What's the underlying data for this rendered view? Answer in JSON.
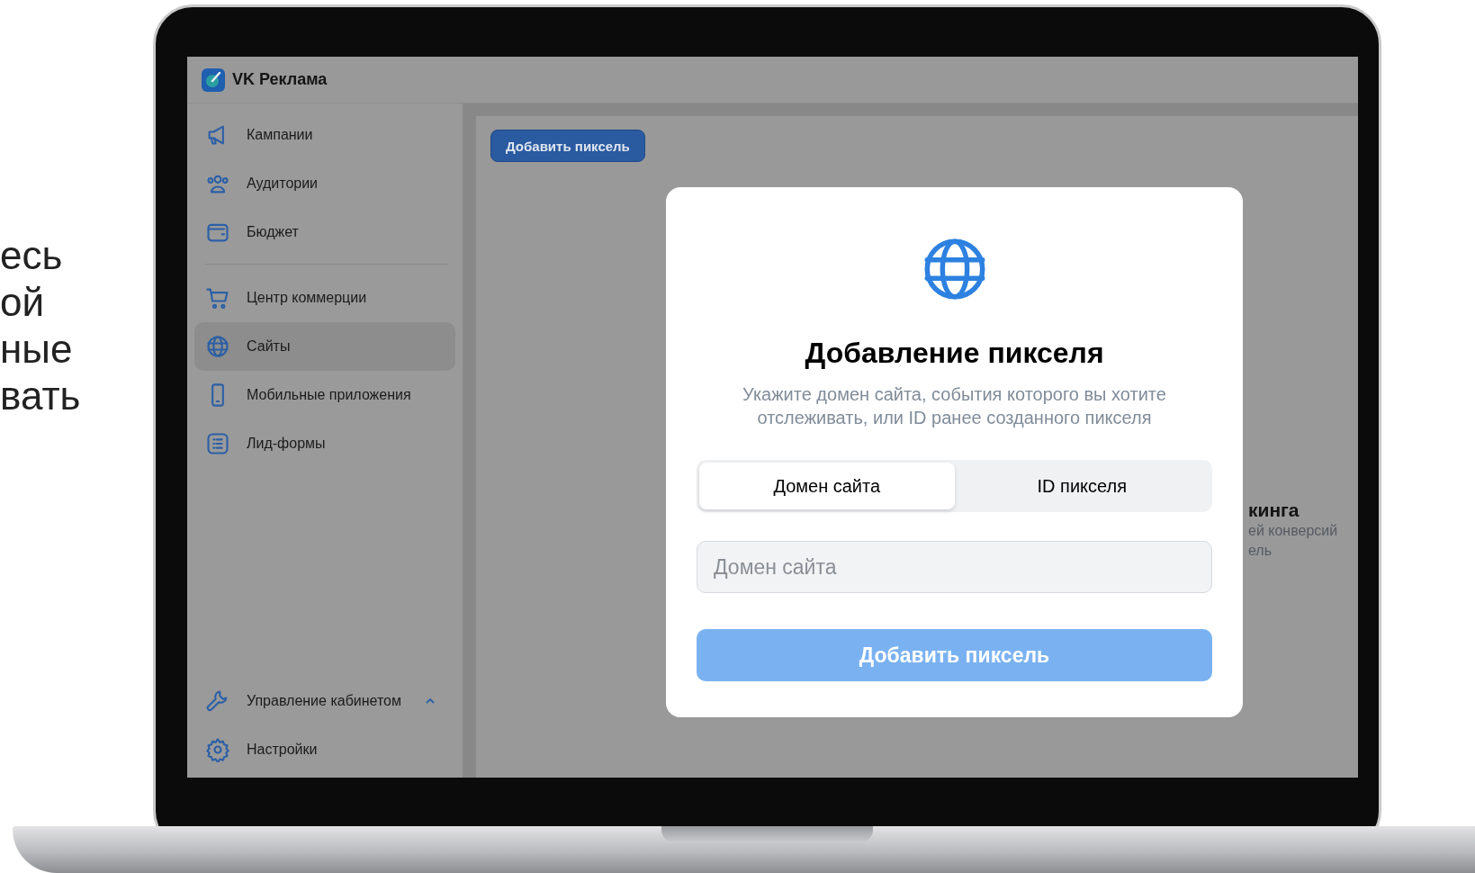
{
  "side_text": [
    "есь",
    "ой",
    "ные",
    "вать"
  ],
  "app": {
    "title": "VK Реклама"
  },
  "sidebar": {
    "items": [
      {
        "label": "Кампании",
        "selected": false
      },
      {
        "label": "Аудитории",
        "selected": false
      },
      {
        "label": "Бюджет",
        "selected": false
      },
      {
        "label": "Центр коммерции",
        "selected": false
      },
      {
        "label": "Сайты",
        "selected": true
      },
      {
        "label": "Мобильные приложения",
        "selected": false
      },
      {
        "label": "Лид-формы",
        "selected": false
      }
    ],
    "group": {
      "label": "Управление кабинетом",
      "expanded": true
    },
    "footer_items": [
      {
        "label": "Настройки",
        "selected": false
      }
    ]
  },
  "main": {
    "button": "Добавить пиксель",
    "card": {
      "title": "кинга",
      "lines": [
        "ей конверсий",
        "ель"
      ]
    }
  },
  "modal": {
    "title": "Добавление пикселя",
    "subtitle": "Укажите домен сайта, события которого  вы хотите\nотслеживать, или ID ранее созданного пикселя",
    "tabs": [
      {
        "label": "Домен сайта",
        "selected": true
      },
      {
        "label": "ID пикселя",
        "selected": false
      }
    ],
    "input": {
      "placeholder": "Домен сайта"
    },
    "submit": {
      "label": "Добавить пиксель",
      "disabled": true
    }
  }
}
